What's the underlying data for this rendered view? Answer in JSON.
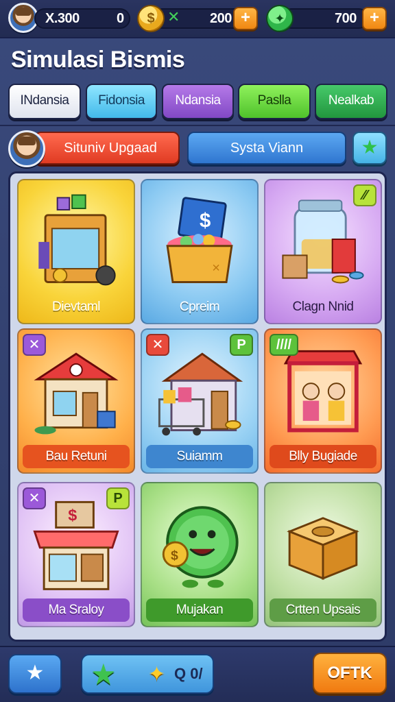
{
  "resources": {
    "currency1": "X.300",
    "currency1_extra": "0",
    "currency2": "200",
    "currency3": "700",
    "coin_symbol": "$",
    "gem_symbol": "✦",
    "x_symbol": "✕",
    "plus": "+"
  },
  "title": "Simulasi Bismis",
  "tabs": [
    {
      "label": "INdansia"
    },
    {
      "label": "Fidonsia"
    },
    {
      "label": "Ndansia"
    },
    {
      "label": "Paslla"
    },
    {
      "label": "Nealkab"
    }
  ],
  "actions": {
    "upgrade_label": "Situniv Upgaad",
    "system_label": "Systa Viann",
    "star_icon": "★"
  },
  "cards": [
    {
      "label": "Dievtaml",
      "badge_left": "",
      "badge_right": ""
    },
    {
      "label": "Cpreim",
      "badge_left": "",
      "badge_right": ""
    },
    {
      "label": "Clagn Nnid",
      "badge_left": "",
      "badge_right": "⁄⁄"
    },
    {
      "label": "Bau Retuni",
      "badge_left": "✕",
      "badge_right": ""
    },
    {
      "label": "Suiamm",
      "badge_left": "✕",
      "badge_right": "P"
    },
    {
      "label": "Blly Bugiade",
      "badge_left": "////",
      "badge_right": ""
    },
    {
      "label": "Ma Sraloy",
      "badge_left": "✕",
      "badge_right": "P"
    },
    {
      "label": "Mujakan",
      "badge_left": "",
      "badge_right": ""
    },
    {
      "label": "Crtten Upsais",
      "badge_left": "",
      "badge_right": ""
    }
  ],
  "bottom": {
    "home_icon": "★",
    "xp_icon": "★",
    "spark_icon": "✦",
    "xp_text": "Q 0/",
    "ok_label": "OFTK"
  }
}
